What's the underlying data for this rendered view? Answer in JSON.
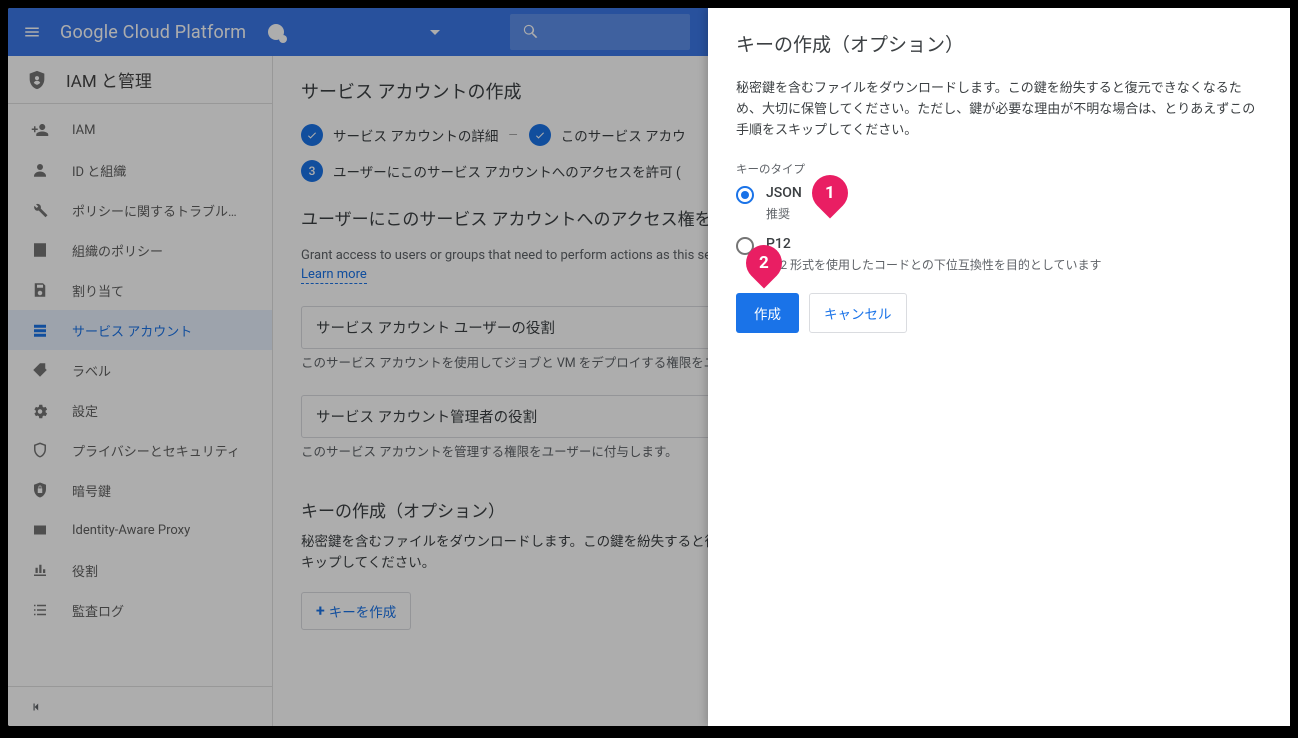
{
  "topbar": {
    "brand": "Google Cloud Platform"
  },
  "sidebar": {
    "title": "IAM と管理",
    "items": [
      {
        "label": "IAM",
        "icon": "person-add"
      },
      {
        "label": "ID と組織",
        "icon": "person"
      },
      {
        "label": "ポリシーに関するトラブル…",
        "icon": "wrench"
      },
      {
        "label": "組織のポリシー",
        "icon": "article"
      },
      {
        "label": "割り当て",
        "icon": "save"
      },
      {
        "label": "サービス アカウント",
        "icon": "service-account"
      },
      {
        "label": "ラベル",
        "icon": "tag"
      },
      {
        "label": "設定",
        "icon": "gear"
      },
      {
        "label": "プライバシーとセキュリティ",
        "icon": "shield"
      },
      {
        "label": "暗号鍵",
        "icon": "lock-q"
      },
      {
        "label": "Identity-Aware Proxy",
        "icon": "badge"
      },
      {
        "label": "役割",
        "icon": "roles"
      },
      {
        "label": "監査ログ",
        "icon": "list"
      }
    ]
  },
  "main": {
    "title": "サービス アカウントの作成",
    "step1": "サービス アカウントの詳細",
    "step2": "このサービス アカウ",
    "step3num": "3",
    "step3": "ユーザーにこのサービス アカウントへのアクセスを許可 (",
    "section_title": "ユーザーにこのサービス アカウントへのアクセス権を\nプション)",
    "section_desc": "Grant access to users or groups that need to perform actions as this servi",
    "learn": "Learn more",
    "role1": "サービス アカウント ユーザーの役割",
    "role1_desc": "このサービス アカウントを使用してジョブと VM をデプロイする権限をユーザ\nます",
    "role2": "サービス アカウント管理者の役割",
    "role2_desc": "このサービス アカウントを管理する権限をユーザーに付与します。",
    "key_title": "キーの作成（オプション）",
    "key_desc": "秘密鍵を含むファイルをダウンロードします。この鍵を紛失すると復元でめ、大切に保管してください。ただし、鍵が必要な理由が不明な場合は、の手順をスキップしてください。",
    "key_btn": "キーを作成"
  },
  "panel": {
    "title": "キーの作成（オプション）",
    "desc": "秘密鍵を含むファイルをダウンロードします。この鍵を紛失すると復元できなくなるため、大切に保管してください。ただし、鍵が必要な理由が不明な場合は、とりあえずこの手順をスキップしてください。",
    "key_type_label": "キーのタイプ",
    "json": "JSON",
    "json_sub": "推奨",
    "p12": "P12",
    "p12_sub": "P12 形式を使用したコードとの下位互換性を目的としています",
    "create": "作成",
    "cancel": "キャンセル"
  },
  "annot": {
    "one": "1",
    "two": "2"
  }
}
